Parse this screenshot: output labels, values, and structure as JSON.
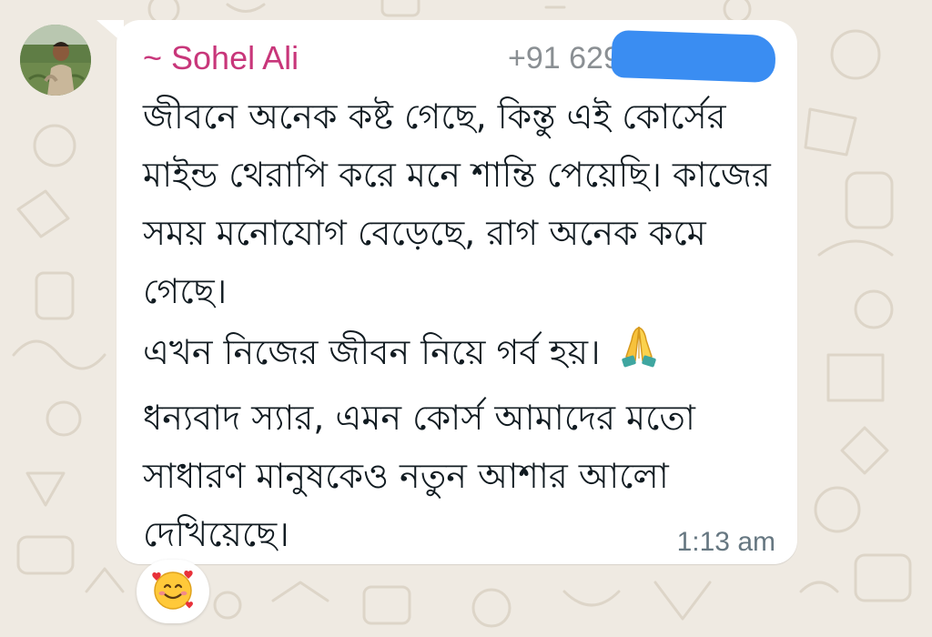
{
  "message": {
    "sender_name": "~ Sohel Ali",
    "sender_phone": "+91 629",
    "paragraphs": [
      "জীবনে অনেক কষ্ট গেছে, কিন্তু এই কোর্সের মাইন্ড থেরাপি করে মনে শান্তি পেয়েছি। কাজের সময় মনোযোগ বেড়েছে, রাগ অনেক কমে গেছে।",
      "এখন নিজের জীবন নিয়ে গর্ব হয়।"
    ],
    "paragraph_3": "ধন্যবাদ স্যার, এমন কোর্স আমাদের মতো সাধারণ মানুষকেও নতুন আশার আলো দেখিয়েছে।",
    "timestamp": "1:13 am"
  },
  "icons": {
    "inline_emoji": "folded-hands-icon",
    "reaction": "smiling-face-with-hearts-icon",
    "avatar": "profile-photo"
  },
  "colors": {
    "sender_name": "#c8367a",
    "chat_background": "#efeae2",
    "bubble": "#ffffff",
    "redaction": "#3a8df2"
  }
}
